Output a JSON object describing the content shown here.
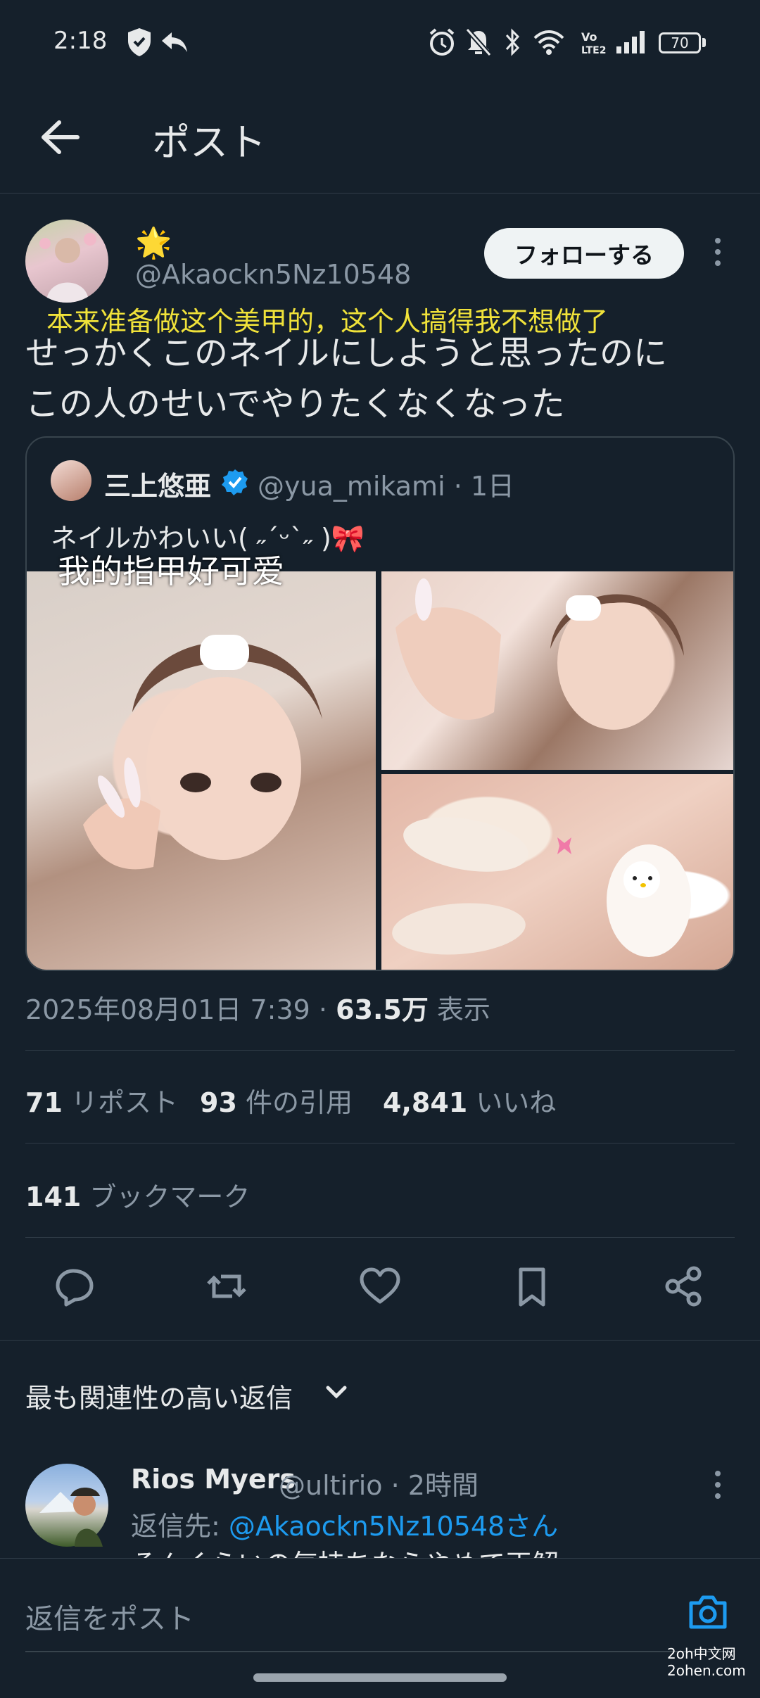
{
  "status_bar": {
    "time": "2:18",
    "battery": "70"
  },
  "header": {
    "title": "ポスト"
  },
  "post": {
    "display_name_emoji": "🌟",
    "handle": "@Akaockn5Nz10548",
    "follow_label": "フォローする",
    "overlay_caption": "本来准备做这个美甲的，这个人搞得我不想做了",
    "text_line1": "せっかくこのネイルにしようと思ったのに",
    "text_line2": "この人のせいでやりたくなくなった"
  },
  "quote": {
    "name": "三上悠亜",
    "handle_time": "@yua_mikami · 1日",
    "text": "ネイルかわいい( ˶ˊᵕˋ˶ )🎀",
    "overlay_caption": "我的指甲好可爱"
  },
  "meta": {
    "date": "2025年08月01日 7:39 · ",
    "views": "63.5万",
    "views_label": " 表示"
  },
  "stats": {
    "reposts": "71",
    "reposts_label": "リポスト",
    "quotes": "93",
    "quotes_label": "件の引用",
    "likes": "4,841",
    "likes_label": "いいね",
    "bookmarks": "141",
    "bookmarks_label": "ブックマーク"
  },
  "replies": {
    "sort_label": "最も関連性の高い返信",
    "first": {
      "name": "Rios Myers",
      "meta": "@ultirio · 2時間",
      "reply_to_prefix": "返信先: ",
      "reply_to_handle": "@Akaockn5Nz10548さん",
      "text": "そんくらいの気持ちならやめて正解"
    }
  },
  "compose": {
    "placeholder": "返信をポスト"
  },
  "watermark": {
    "line1": "2oh中文网",
    "line2": "2ohen.com"
  },
  "colors": {
    "background": "#15202b",
    "accent": "#1d9bf0",
    "secondary_text": "#8b98a5"
  }
}
